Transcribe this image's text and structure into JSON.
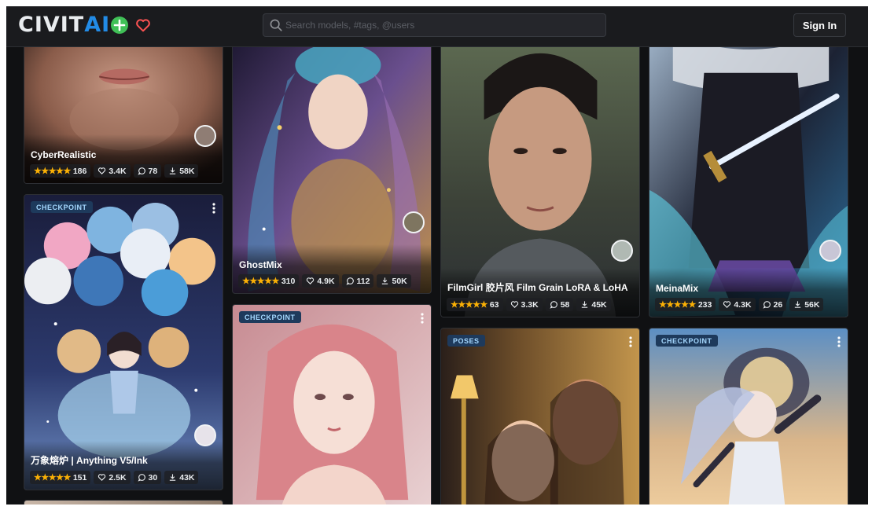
{
  "header": {
    "logo_part1": "CIVIT",
    "logo_part2": "AI",
    "search_placeholder": "Search models, #tags, @users",
    "sign_in": "Sign In"
  },
  "colors": {
    "accent": "#228be6",
    "add": "#40c057",
    "favorite": "#fa5252",
    "stars": "#fab005"
  },
  "cards": [
    {
      "title": "CyberRealistic",
      "rating": "★★★★★",
      "ratings_count": "186",
      "likes": "3.4K",
      "comments": "78",
      "downloads": "58K"
    },
    {
      "title": "GhostMix",
      "rating": "★★★★★",
      "ratings_count": "310",
      "likes": "4.9K",
      "comments": "112",
      "downloads": "50K"
    },
    {
      "title": "FilmGirl 胶片风 Film Grain LoRA & LoHA",
      "rating": "★★★★★",
      "ratings_count": "63",
      "likes": "3.3K",
      "comments": "58",
      "downloads": "45K"
    },
    {
      "title": "MeinaMix",
      "rating": "★★★★★",
      "ratings_count": "233",
      "likes": "4.3K",
      "comments": "26",
      "downloads": "56K"
    },
    {
      "badge": "CHECKPOINT",
      "title": "万象熔炉 | Anything V5/Ink",
      "rating": "★★★★★",
      "ratings_count": "151",
      "likes": "2.5K",
      "comments": "30",
      "downloads": "43K"
    },
    {
      "badge": "CHECKPOINT"
    },
    {
      "badge": "POSES"
    },
    {
      "badge": "CHECKPOINT"
    }
  ],
  "icons": [
    "add-icon",
    "heart-icon",
    "search-icon",
    "kebab-menu-icon",
    "comment-icon",
    "download-icon"
  ]
}
